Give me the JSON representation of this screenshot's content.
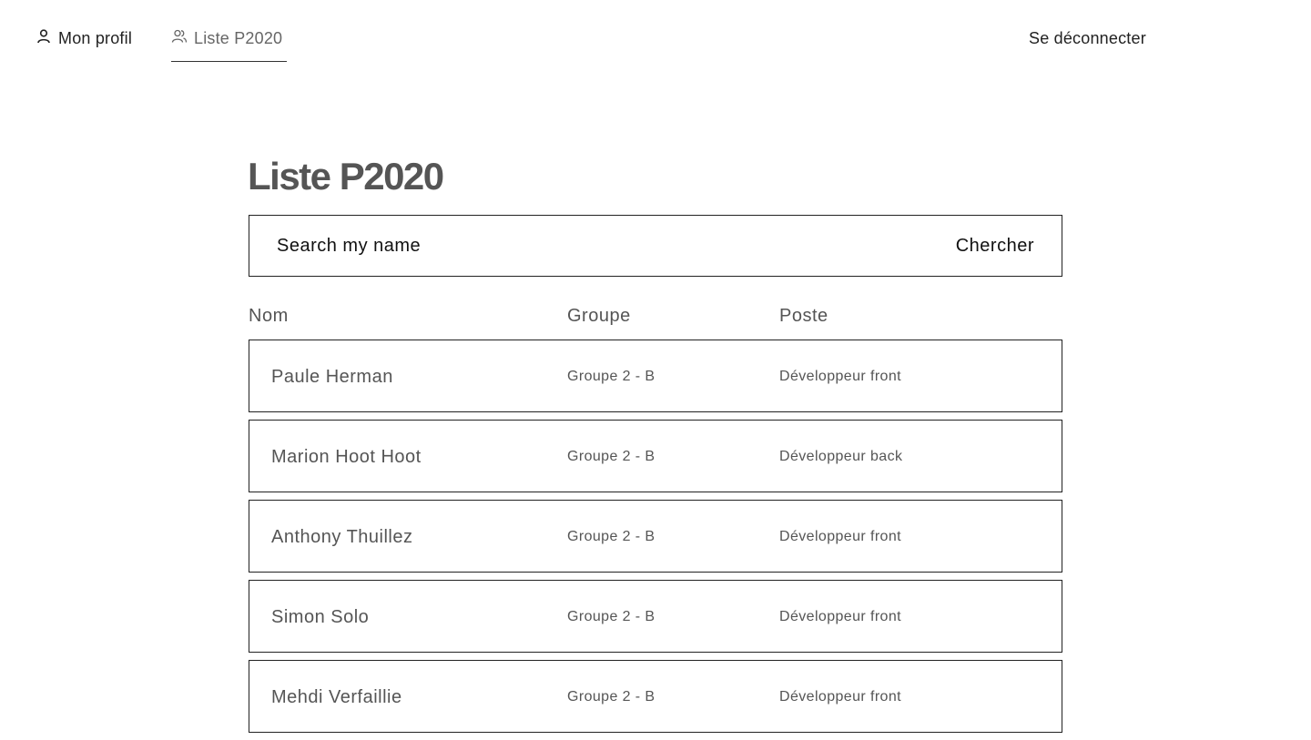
{
  "nav": {
    "profile_label": "Mon profil",
    "profile_icon": "user-icon",
    "list_label": "Liste P2020",
    "list_icon": "users-icon",
    "logout_label": "Se déconnecter"
  },
  "main": {
    "title": "Liste P2020",
    "search": {
      "placeholder": "Search my name",
      "value": "",
      "button_label": "Chercher"
    },
    "table": {
      "headers": {
        "name": "Nom",
        "group": "Groupe",
        "poste": "Poste"
      },
      "rows": [
        {
          "name": "Paule Herman",
          "group": "Groupe 2 - B",
          "poste": "Développeur front"
        },
        {
          "name": "Marion Hoot Hoot",
          "group": "Groupe 2 - B",
          "poste": "Développeur back"
        },
        {
          "name": "Anthony Thuillez",
          "group": "Groupe 2 - B",
          "poste": "Développeur front"
        },
        {
          "name": "Simon Solo",
          "group": "Groupe 2 - B",
          "poste": "Développeur front"
        },
        {
          "name": "Mehdi Verfaillie",
          "group": "Groupe 2 - B",
          "poste": "Développeur front"
        }
      ]
    }
  },
  "colors": {
    "text_primary": "#222222",
    "text_secondary": "#555555",
    "border": "#222222",
    "background": "#ffffff"
  }
}
